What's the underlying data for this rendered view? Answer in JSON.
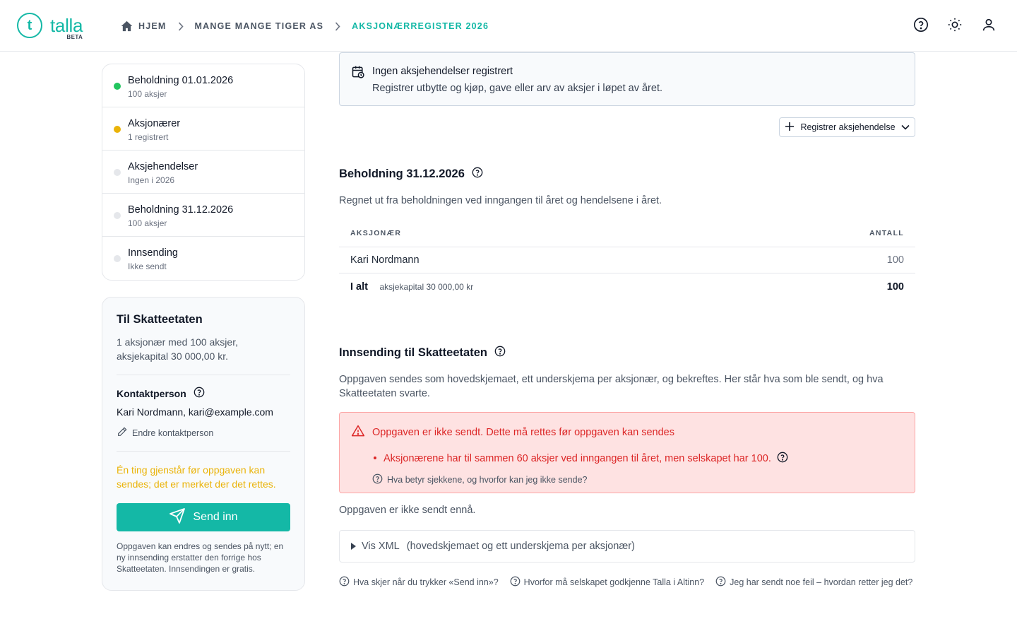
{
  "app": {
    "name": "talla",
    "badge": "BETA",
    "logo_glyph": "t"
  },
  "breadcrumb": [
    {
      "label": "HJEM"
    },
    {
      "label": "MANGE MANGE TIGER AS"
    },
    {
      "label": "AKSJONÆRREGISTER 2026"
    }
  ],
  "header_icons": [
    "help-circle-icon",
    "sun-icon",
    "user-icon"
  ],
  "steps": [
    {
      "title": "Beholdning 01.01.2026",
      "sub": "100 aksjer",
      "status_color": "#22c55e"
    },
    {
      "title": "Aksjonærer",
      "sub": "1 registrert",
      "status_color": "#eab308"
    },
    {
      "title": "Aksjehendelser",
      "sub": "Ingen i 2026",
      "status_color": "#e5e7eb"
    },
    {
      "title": "Beholdning 31.12.2026",
      "sub": "100 aksjer",
      "status_color": "#e5e7eb"
    },
    {
      "title": "Innsending",
      "sub": "Ikke sendt",
      "status_color": "#e5e7eb"
    }
  ],
  "skatt_panel": {
    "title": "Til Skatteetaten",
    "summary": "1 aksjonær med 100 aksjer, aksjekapital 30 000,00 kr.",
    "contact_label": "Kontaktperson",
    "contact_value": "Kari Nordmann, kari@example.com",
    "edit_contact": "Endre kontaktperson",
    "warning": "Én ting gjenstår før oppgaven kan sendes; det er merket der det rettes.",
    "send_label": "Send inn",
    "note": "Oppgaven kan endres og sendes på nytt; en ny innsending erstatter den forrige hos Skatteetaten. Innsendingen er gratis."
  },
  "events": {
    "empty_title": "Ingen aksjehendelser registrert",
    "empty_sub": "Registrer utbytte og kjøp, gave eller arv av aksjer i løpet av året.",
    "register_button": "Registrer aksjehendelse"
  },
  "holding": {
    "title": "Beholdning 31.12.2026",
    "description": "Regnet ut fra beholdningen ved inngangen til året og hendelsene i året.",
    "columns": [
      "AKSJONÆR",
      "ANTALL"
    ],
    "rows": [
      {
        "name": "Kari Nordmann",
        "count": "100"
      }
    ],
    "total_label": "I alt",
    "total_capital": "aksjekapital 30 000,00 kr",
    "total_count": "100"
  },
  "submission": {
    "title": "Innsending til Skatteetaten",
    "description": "Oppgaven sendes som hovedskjemaet, ett underskjema per aksjonær, og bekreftes. Her står hva som ble sendt, og hva Skatteetaten svarte.",
    "error_title": "Oppgaven er ikke sendt. Dette må rettes før oppgaven kan sendes",
    "error_item": "Aksjonærene har til sammen 60 aksjer ved inngangen til året, men selskapet har 100.",
    "error_help": "Hva betyr sjekkene, og hvorfor kan jeg ikke sende?",
    "status": "Oppgaven er ikke sendt ennå.",
    "xml_toggle": "Vis XML",
    "xml_hint": "(hovedskjemaet og ett underskjema per aksjonær)"
  },
  "faq": [
    "Hva skjer når du trykker «Send inn»?",
    "Hvorfor må selskapet godkjenne Talla i Altinn?",
    "Jeg har sendt noe feil – hvordan retter jeg det?"
  ],
  "colors": {
    "accent": "#14b8a6",
    "error": "#dc2626",
    "warning": "#eab308",
    "success": "#22c55e"
  }
}
